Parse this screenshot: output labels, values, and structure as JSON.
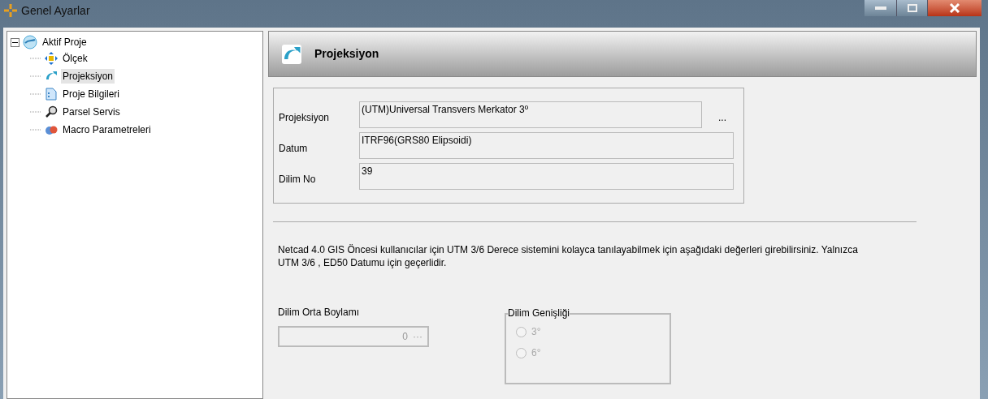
{
  "window": {
    "title": "Genel Ayarlar"
  },
  "tree": {
    "label": "Aktif Proje",
    "expanded": true,
    "selected": false,
    "children": [
      {
        "label": "Ölçek",
        "kind": "scale",
        "selected": false
      },
      {
        "label": "Projeksiyon",
        "kind": "projection",
        "selected": true
      },
      {
        "label": "Proje Bilgileri",
        "kind": "info",
        "selected": false
      },
      {
        "label": "Parsel Servis",
        "kind": "search",
        "selected": false
      },
      {
        "label": "Macro Parametreleri",
        "kind": "macro",
        "selected": false
      }
    ]
  },
  "panel": {
    "title": "Projeksiyon"
  },
  "fields": [
    {
      "label": "Projeksiyon",
      "value": "(UTM)Universal Transvers Merkator 3º",
      "button": "..."
    },
    {
      "label": "Datum",
      "value": "ITRF96(GRS80 Elipsoidi)"
    },
    {
      "label": "Dilim No",
      "value": "39"
    }
  ],
  "note": "Netcad 4.0 GIS Öncesi kullanıcılar için UTM 3/6 Derece sistemini kolayca tanılayabilmek için aşağıdaki değerleri girebilirsiniz. Yalnızca UTM 3/6 , ED50 Datumu için geçerlidir.",
  "central_meridian": {
    "label": "Dilim Orta Boylamı",
    "value": "0",
    "button": "···",
    "disabled": true
  },
  "zone_width": {
    "title": "Dilim Genişliği",
    "disabled": true,
    "options": [
      {
        "label": "3°",
        "selected": false
      },
      {
        "label": "6°",
        "selected": false
      }
    ]
  }
}
